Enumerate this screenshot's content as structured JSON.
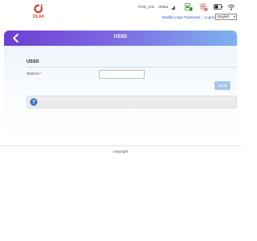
{
  "brand": {
    "logo_text": "OLAX",
    "logo_color": "#d83a2e"
  },
  "status_bar": {
    "network_name": "POD_LTE",
    "signal_value": "00911",
    "icons": [
      "signal-icon",
      "sim-icon",
      "usb-icon",
      "battery-icon",
      "wifi-icon"
    ]
  },
  "top_links": {
    "modify_password": "Modify Login Password",
    "logout": "Logout",
    "language": "English"
  },
  "header": {
    "title": "USSD",
    "back_icon": "chevron-left-icon"
  },
  "form": {
    "section_title": "USSD",
    "send_to_label": "Send to",
    "required_mark": "*",
    "send_to_value": "",
    "send_button": "Send"
  },
  "info": {
    "icon": "question-icon",
    "message": ""
  },
  "footer": {
    "copyright": "copyright"
  },
  "colors": {
    "banner_start": "#6b3fd3",
    "banner_end": "#7eb2ef",
    "link": "#2d57b8",
    "send_button": "#a9c6ea",
    "info_icon": "#3d73c4"
  }
}
